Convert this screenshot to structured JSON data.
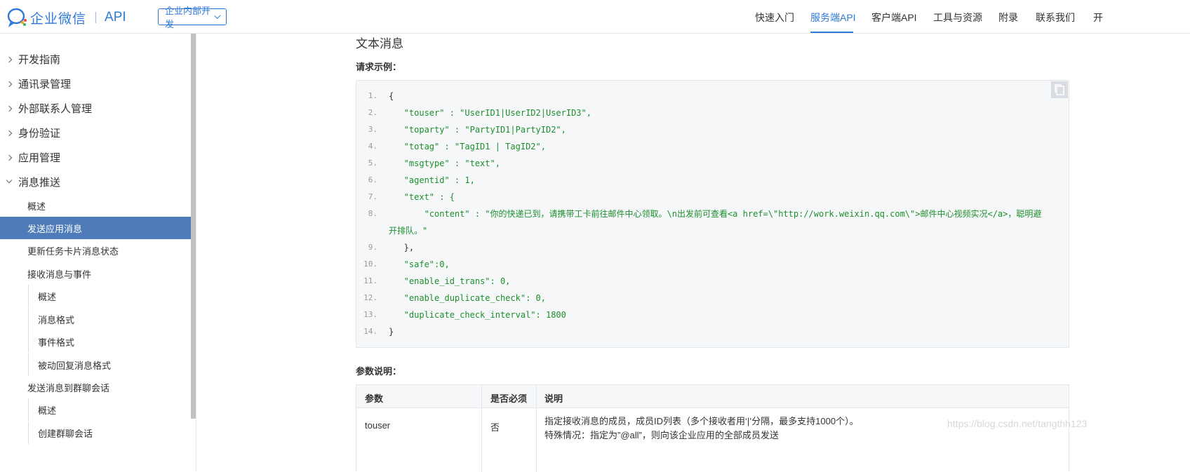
{
  "header": {
    "logo_text": "企业微信",
    "logo_api": "API",
    "dropdown_label": "企业内部开发",
    "nav": [
      "快速入门",
      "服务端API",
      "客户端API",
      "工具与资源",
      "附录",
      "联系我们",
      "开"
    ]
  },
  "sidebar": {
    "top_items": [
      "开发指南",
      "通讯录管理",
      "外部联系人管理",
      "身份验证",
      "应用管理",
      "消息推送"
    ],
    "sub_items": [
      "概述",
      "发送应用消息",
      "更新任务卡片消息状态",
      "接收消息与事件"
    ],
    "sub_sub_items_1": [
      "概述",
      "消息格式",
      "事件格式",
      "被动回复消息格式"
    ],
    "sub_items_2": [
      "发送消息到群聊会话"
    ],
    "sub_sub_items_2": [
      "概述",
      "创建群聊会话"
    ]
  },
  "main": {
    "title": "文本消息",
    "request_label": "请求示例：",
    "params_label": "参数说明：",
    "code_lines": [
      {
        "n": "1.",
        "text": "{"
      },
      {
        "n": "2.",
        "text": "   \"touser\" : \"UserID1|UserID2|UserID3\","
      },
      {
        "n": "3.",
        "text": "   \"toparty\" : \"PartyID1|PartyID2\","
      },
      {
        "n": "4.",
        "text": "   \"totag\" : \"TagID1 | TagID2\","
      },
      {
        "n": "5.",
        "text": "   \"msgtype\" : \"text\","
      },
      {
        "n": "6.",
        "text": "   \"agentid\" : 1,"
      },
      {
        "n": "7.",
        "text": "   \"text\" : {"
      },
      {
        "n": "8.",
        "text": "       \"content\" : \"你的快递已到，请携带工卡前往邮件中心领取。\\n出发前可查看<a href=\\\"http://work.weixin.qq.com\\\">邮件中心视频实况</a>，聪明避"
      },
      {
        "n": "",
        "text": "开排队。\""
      },
      {
        "n": "9.",
        "text": "   },"
      },
      {
        "n": "10.",
        "text": "   \"safe\":0,"
      },
      {
        "n": "11.",
        "text": "   \"enable_id_trans\": 0,"
      },
      {
        "n": "12.",
        "text": "   \"enable_duplicate_check\": 0,"
      },
      {
        "n": "13.",
        "text": "   \"duplicate_check_interval\": 1800"
      },
      {
        "n": "14.",
        "text": "}"
      }
    ],
    "table": {
      "headers": [
        "参数",
        "是否必须",
        "说明"
      ],
      "rows": [
        {
          "param": "touser",
          "required": "否",
          "desc_line1": "指定接收消息的成员，成员ID列表（多个接收者用‘|’分隔，最多支持1000个）。",
          "desc_line2": "特殊情况：指定为”@all”，则向该企业应用的全部成员发送"
        }
      ]
    }
  },
  "watermark": "https://blog.csdn.net/tangthh123",
  "colors": {
    "accent": "#2f7ad6",
    "sidebar_active": "#4f7cb8",
    "code_string": "#1c8e2c"
  }
}
